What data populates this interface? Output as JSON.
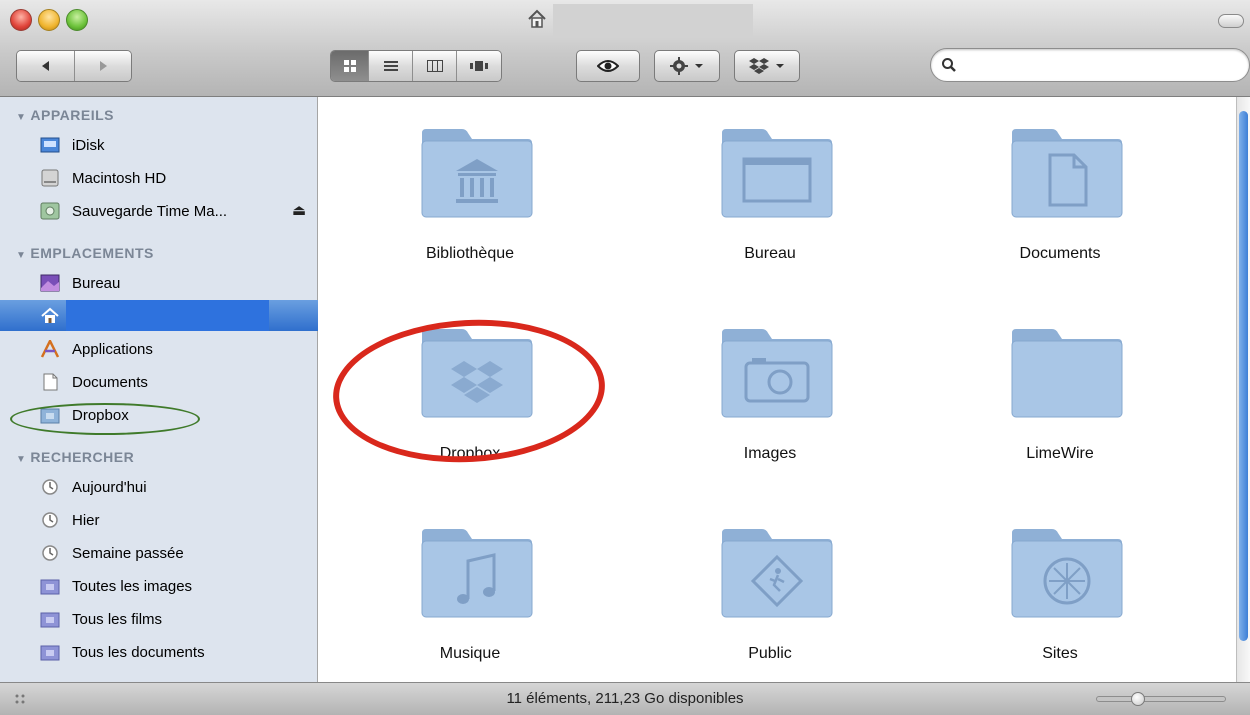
{
  "window": {
    "title": ""
  },
  "toolbar": {
    "views": [
      "icon-view",
      "list-view",
      "column-view",
      "cover-flow-view"
    ],
    "active_view": 0,
    "search": {
      "placeholder": "",
      "value": ""
    }
  },
  "sidebar": {
    "sections": [
      {
        "title": "APPAREILS",
        "items": [
          {
            "label": "iDisk",
            "icon": "idisk-icon"
          },
          {
            "label": "Macintosh HD",
            "icon": "harddisk-icon"
          },
          {
            "label": "Sauvegarde Time Ma...",
            "icon": "time-machine-disk-icon",
            "eject": true
          }
        ]
      },
      {
        "title": "EMPLACEMENTS",
        "items": [
          {
            "label": "Bureau",
            "icon": "desktop-icon"
          },
          {
            "label": "",
            "icon": "home-icon",
            "selected": true
          },
          {
            "label": "Applications",
            "icon": "applications-icon"
          },
          {
            "label": "Documents",
            "icon": "documents-icon"
          },
          {
            "label": "Dropbox",
            "icon": "dropbox-folder-icon"
          }
        ]
      },
      {
        "title": "RECHERCHER",
        "items": [
          {
            "label": "Aujourd'hui",
            "icon": "clock-icon"
          },
          {
            "label": "Hier",
            "icon": "clock-icon"
          },
          {
            "label": "Semaine passée",
            "icon": "clock-icon"
          },
          {
            "label": "Toutes les images",
            "icon": "smart-folder-icon"
          },
          {
            "label": "Tous les films",
            "icon": "smart-folder-icon"
          },
          {
            "label": "Tous les documents",
            "icon": "smart-folder-icon"
          }
        ]
      }
    ]
  },
  "content": {
    "folders": [
      {
        "name": "Bibliothèque",
        "icon": "library-folder-icon"
      },
      {
        "name": "Bureau",
        "icon": "desktop-folder-icon"
      },
      {
        "name": "Documents",
        "icon": "documents-folder-icon"
      },
      {
        "name": "Dropbox",
        "icon": "dropbox-folder-icon"
      },
      {
        "name": "Images",
        "icon": "pictures-folder-icon"
      },
      {
        "name": "LimeWire",
        "icon": "folder-icon"
      },
      {
        "name": "Musique",
        "icon": "music-folder-icon"
      },
      {
        "name": "Public",
        "icon": "public-folder-icon"
      },
      {
        "name": "Sites",
        "icon": "sites-folder-icon"
      }
    ]
  },
  "status": {
    "text": "11 éléments, 211,23 Go disponibles",
    "icon_size": 0.3
  },
  "annotations": {
    "red_circle_color": "#d9281c",
    "green_circle_color": "#3f7a2a"
  }
}
